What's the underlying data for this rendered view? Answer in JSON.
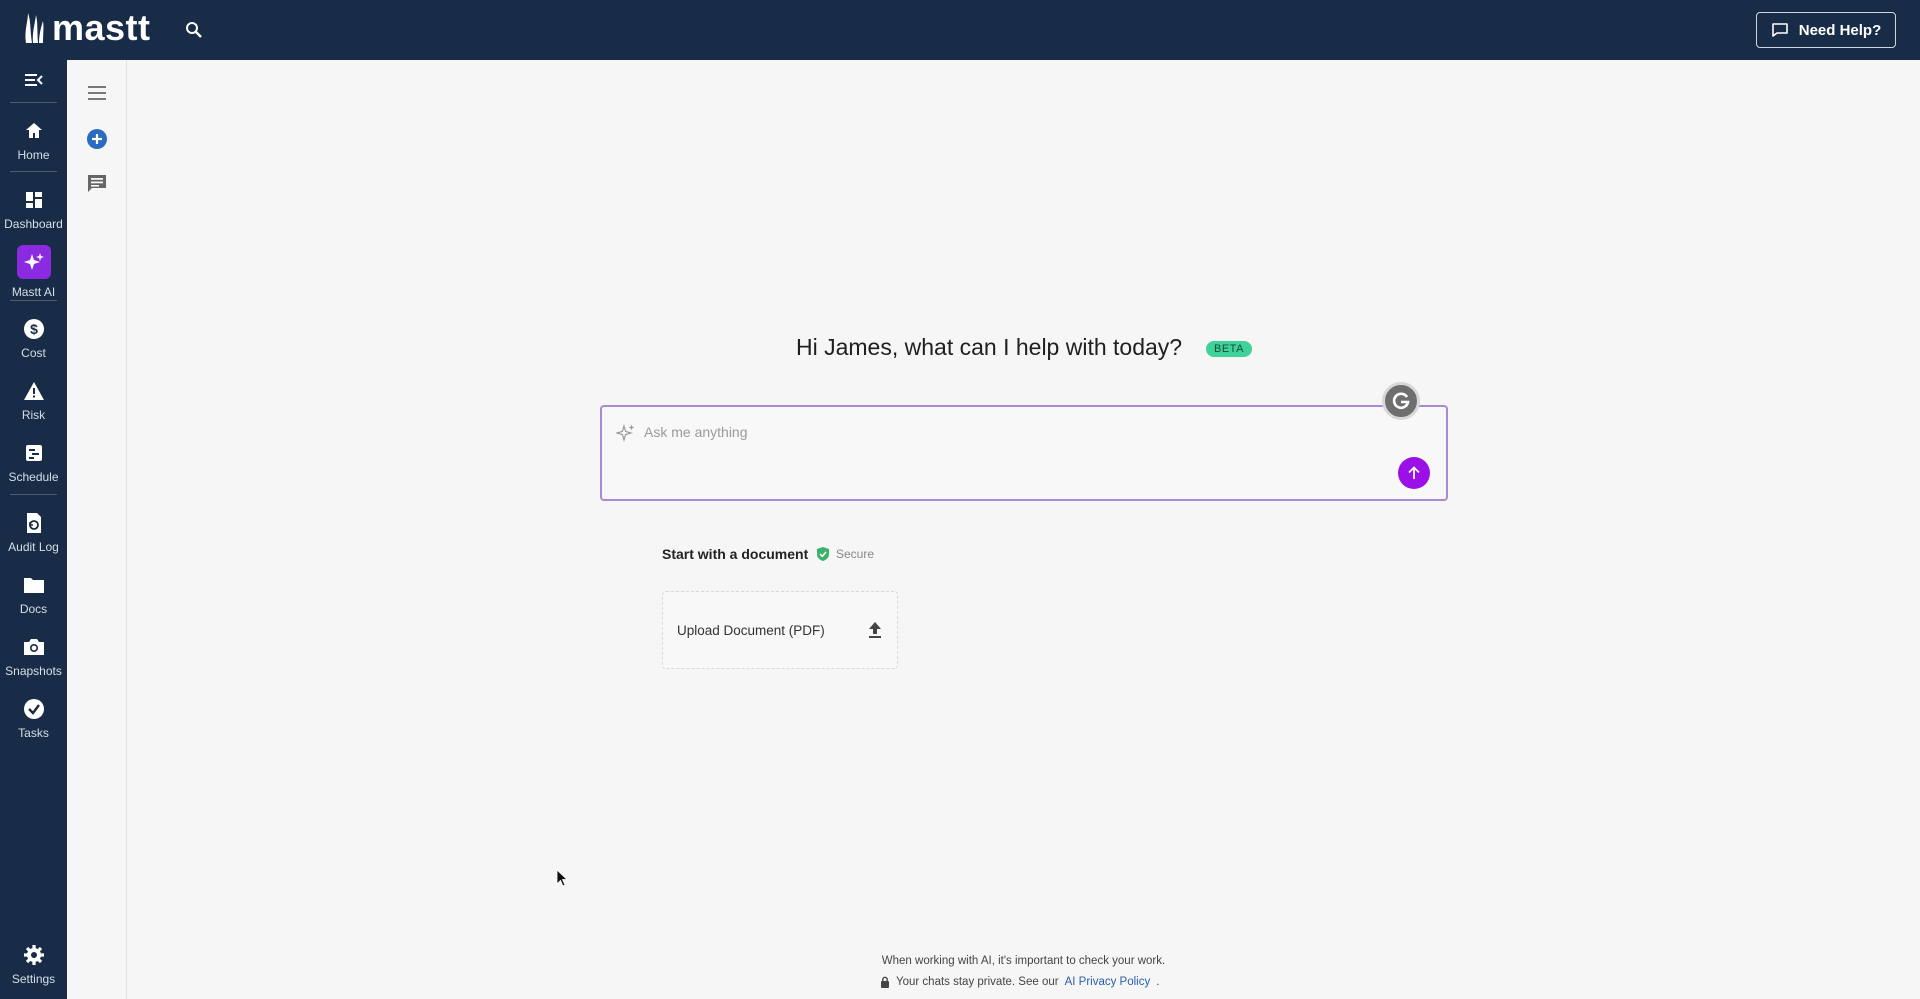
{
  "app": {
    "brand": "mastt",
    "help_label": "Need Help?"
  },
  "nav": {
    "items": [
      {
        "label": "Home",
        "icon": "home-icon"
      },
      {
        "label": "Dashboard",
        "icon": "dashboard-icon"
      },
      {
        "label": "Mastt AI",
        "icon": "sparkle-icon"
      },
      {
        "label": "Cost",
        "icon": "dollar-icon"
      },
      {
        "label": "Risk",
        "icon": "warning-icon"
      },
      {
        "label": "Schedule",
        "icon": "schedule-icon"
      },
      {
        "label": "Audit Log",
        "icon": "audit-icon"
      },
      {
        "label": "Docs",
        "icon": "folder-icon"
      },
      {
        "label": "Snapshots",
        "icon": "camera-icon"
      },
      {
        "label": "Tasks",
        "icon": "check-circle-icon"
      }
    ],
    "settings_label": "Settings"
  },
  "main": {
    "greeting": "Hi James, what can I help with today?",
    "badge": "BETA",
    "ask_placeholder": "Ask me anything",
    "doc_heading": "Start with a document",
    "secure_label": "Secure",
    "upload_label": "Upload Document (PDF)"
  },
  "footer": {
    "line1": "When working with AI, it's important to check your work.",
    "line2_text": "Your chats stay private. See our",
    "line2_link": "AI Privacy Policy",
    "line2_end": "."
  },
  "colors": {
    "topbar": "#182c47",
    "accent": "#9a10e6",
    "badge": "#3ed39a",
    "secure": "#3bb26b"
  }
}
